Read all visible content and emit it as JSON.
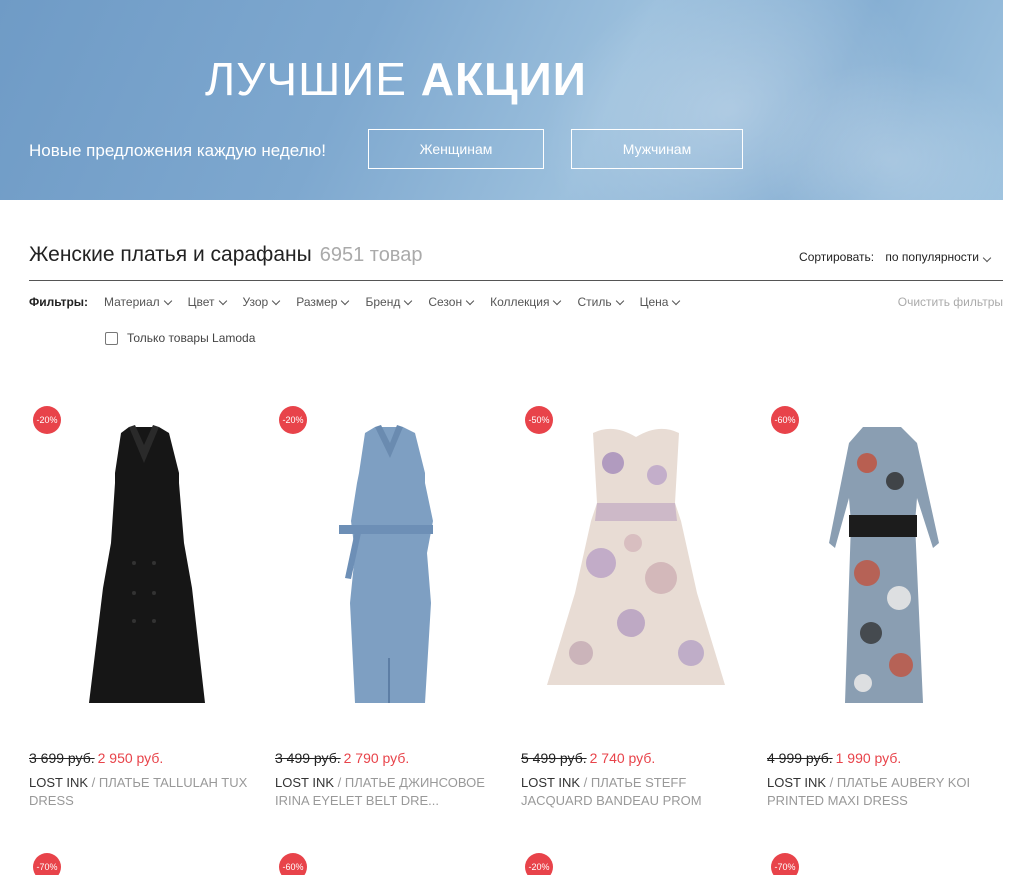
{
  "banner": {
    "title_light": "ЛУЧШИЕ",
    "title_bold": "АКЦИИ",
    "subtitle": "Новые предложения каждую неделю!",
    "btn_women": "Женщинам",
    "btn_men": "Мужчинам"
  },
  "catalog": {
    "title": "Женские платья и сарафаны",
    "count": "6951 товар",
    "sort_label": "Сортировать:",
    "sort_value": "по популярности",
    "filters_label": "Фильтры:",
    "filters": [
      "Материал",
      "Цвет",
      "Узор",
      "Размер",
      "Бренд",
      "Сезон",
      "Коллекция",
      "Стиль",
      "Цена"
    ],
    "clear_filters": "Очистить фильтры",
    "lamoda_only": "Только товары Lamoda"
  },
  "products": [
    {
      "badge": "-20%",
      "old_price": "3 699 руб.",
      "new_price": "2 950 руб.",
      "brand": "LOST INK",
      "name": " / Платье TALLULAH TUX DRESS"
    },
    {
      "badge": "-20%",
      "old_price": "3 499 руб.",
      "new_price": "2 790 руб.",
      "brand": "LOST INK",
      "name": " / Платье джинсовое IRINA EYELET BELT DRE..."
    },
    {
      "badge": "-50%",
      "old_price": "5 499 руб.",
      "new_price": "2 740 руб.",
      "brand": "LOST INK",
      "name": " / Платье STEFF JACQUARD BANDEAU PROM"
    },
    {
      "badge": "-60%",
      "old_price": "4 999 руб.",
      "new_price": "1 990 руб.",
      "brand": "LOST INK",
      "name": " / Платье AUBERY KOI PRINTED MAXI DRESS"
    }
  ],
  "next_row_badges": [
    "-70%",
    "-60%",
    "-20%",
    "-70%"
  ],
  "colors": {
    "accent_red": "#e8434a",
    "banner_blue": "#7ea8cf"
  }
}
